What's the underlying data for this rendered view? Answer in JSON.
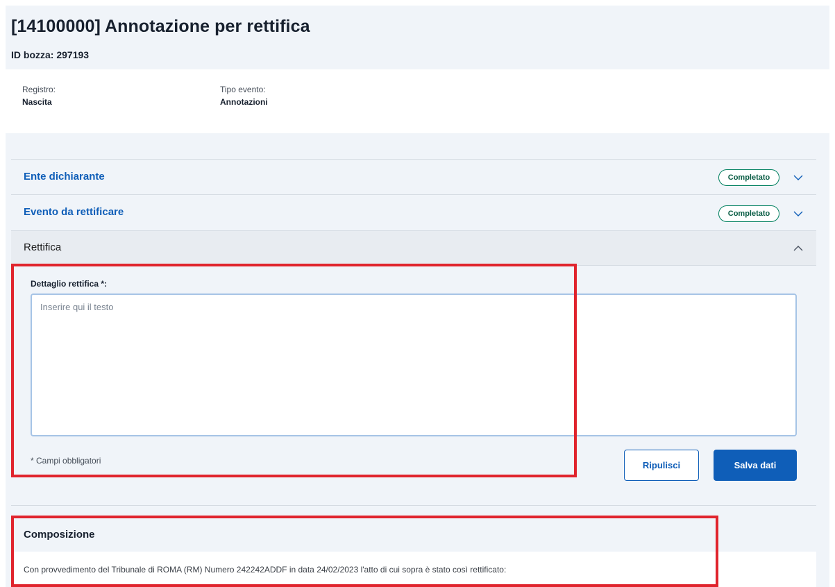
{
  "header": {
    "title": "[14100000] Annotazione per rettifica",
    "draft_id": "ID bozza: 297193"
  },
  "meta": {
    "registro_label": "Registro:",
    "registro_value": "Nascita",
    "tipo_evento_label": "Tipo evento:",
    "tipo_evento_value": "Annotazioni"
  },
  "sections": [
    {
      "title": "Ente dichiarante",
      "status": "Completato",
      "expanded": false,
      "chevron": "chevron-down-icon"
    },
    {
      "title": "Evento da rettificare",
      "status": "Completato",
      "expanded": false,
      "chevron": "chevron-down-icon"
    },
    {
      "title": "Rettifica",
      "status": "",
      "expanded": true,
      "chevron": "chevron-up-icon"
    }
  ],
  "rettifica": {
    "field_label": "Dettaglio rettifica *:",
    "placeholder": "Inserire qui il testo",
    "value": "",
    "required_note": "* Campi obbligatori",
    "clear_label": "Ripulisci",
    "save_label": "Salva dati"
  },
  "composizione": {
    "title": "Composizione",
    "text": "Con provvedimento del Tribunale di ROMA (RM) Numero 242242ADDF in data 24/02/2023 l'atto di cui sopra è stato così rettificato:"
  },
  "colors": {
    "accent": "#0f5eb8",
    "status_green": "#00805f",
    "annotation_red": "#e0242d",
    "panel_bg": "#f0f4f9"
  }
}
